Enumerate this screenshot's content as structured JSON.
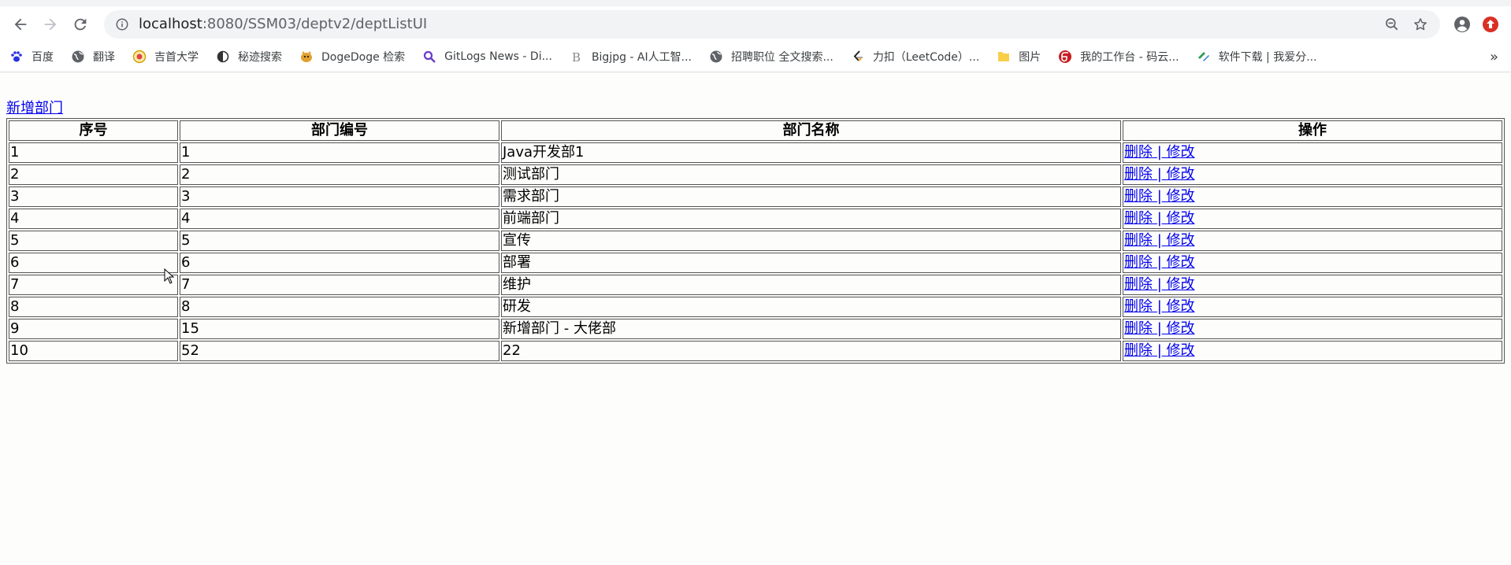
{
  "browser": {
    "url_host": "localhost",
    "url_path": ":8080/SSM03/deptv2/deptListUI"
  },
  "bookmarks": [
    {
      "label": "百度",
      "icon": "baidu-paw-icon",
      "color": "#2932e1"
    },
    {
      "label": "翻译",
      "icon": "globe-icon",
      "color": "#5f6368"
    },
    {
      "label": "吉首大学",
      "icon": "university-logo-icon",
      "color": "#c8a000"
    },
    {
      "label": "秘迹搜索",
      "icon": "secret-search-icon",
      "color": "#333333"
    },
    {
      "label": "DogeDoge 检索",
      "icon": "doge-icon",
      "color": "#e0a030"
    },
    {
      "label": "GitLogs News - Di...",
      "icon": "magnifier-icon",
      "color": "#6a3cc8"
    },
    {
      "label": "Bigjpg - AI人工智...",
      "icon": "bigjpg-icon",
      "color": "#888888"
    },
    {
      "label": "招聘职位 全文搜索...",
      "icon": "globe-icon",
      "color": "#5f6368"
    },
    {
      "label": "力扣（LeetCode）...",
      "icon": "leetcode-icon",
      "color": "#f89f1b"
    },
    {
      "label": "图片",
      "icon": "folder-icon",
      "color": "#f9cf4a"
    },
    {
      "label": "我的工作台 - 码云...",
      "icon": "gitee-icon",
      "color": "#c71d23"
    },
    {
      "label": "软件下载 | 我爱分...",
      "icon": "software-icon",
      "color": "#2e9e5b"
    }
  ],
  "page": {
    "add_link": "新增部门",
    "headers": [
      "序号",
      "部门编号",
      "部门名称",
      "操作"
    ],
    "rows": [
      {
        "index": "1",
        "dept_no": "1",
        "dept_name": "Java开发部1"
      },
      {
        "index": "2",
        "dept_no": "2",
        "dept_name": "测试部门"
      },
      {
        "index": "3",
        "dept_no": "3",
        "dept_name": "需求部门"
      },
      {
        "index": "4",
        "dept_no": "4",
        "dept_name": "前端部门"
      },
      {
        "index": "5",
        "dept_no": "5",
        "dept_name": "宣传"
      },
      {
        "index": "6",
        "dept_no": "6",
        "dept_name": "部署"
      },
      {
        "index": "7",
        "dept_no": "7",
        "dept_name": "维护"
      },
      {
        "index": "8",
        "dept_no": "8",
        "dept_name": "研发"
      },
      {
        "index": "9",
        "dept_no": "15",
        "dept_name": "新增部门 - 大佬部"
      },
      {
        "index": "10",
        "dept_no": "52",
        "dept_name": "22"
      }
    ],
    "action_delete": "删除",
    "action_separator": " | ",
    "action_edit": "修改"
  },
  "colors": {
    "link": "#0000ee",
    "toolbar_bg": "#ffffff",
    "omnibox_bg": "#f1f3f4"
  }
}
